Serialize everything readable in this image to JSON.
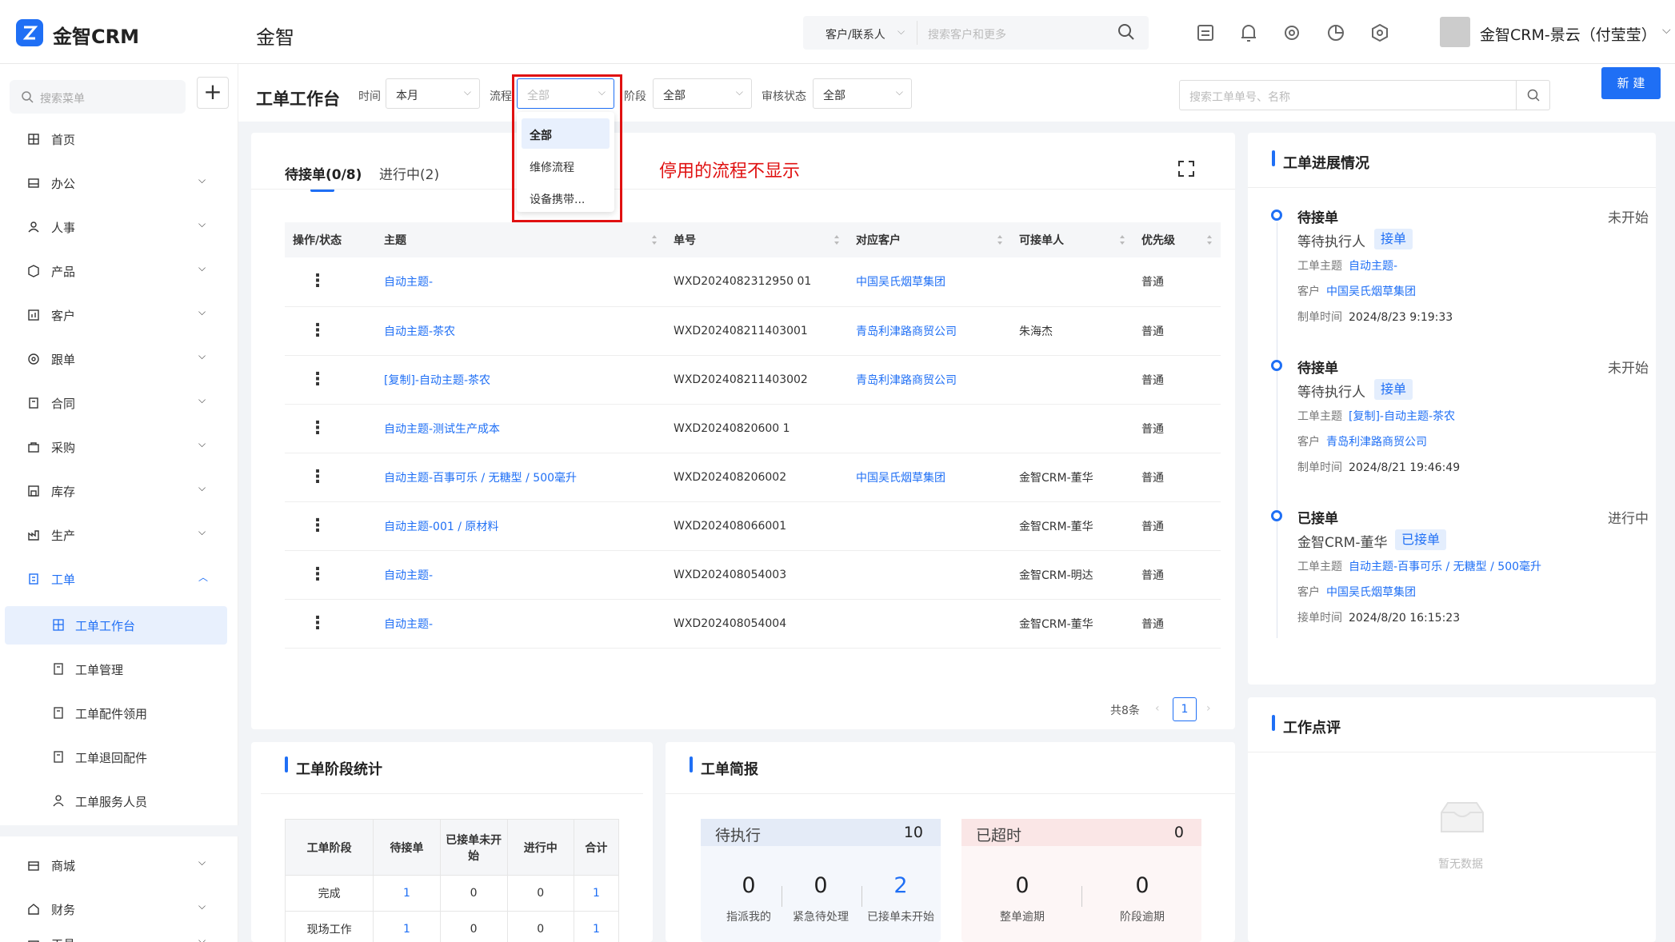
{
  "header": {
    "logo_text": "金智CRM",
    "app_name": "金智",
    "search_type": "客户/联系人",
    "search_placeholder": "搜索客户和更多",
    "user_name": "金智CRM-景云（付莹莹）"
  },
  "sidebar": {
    "search_placeholder": "搜索菜单",
    "items": [
      {
        "label": "首页",
        "icon": "grid-icon"
      },
      {
        "label": "办公",
        "icon": "inbox-icon"
      },
      {
        "label": "人事",
        "icon": "person-icon"
      },
      {
        "label": "产品",
        "icon": "box-icon"
      },
      {
        "label": "客户",
        "icon": "chart-icon"
      },
      {
        "label": "跟单",
        "icon": "target-icon"
      },
      {
        "label": "合同",
        "icon": "contract-icon"
      },
      {
        "label": "采购",
        "icon": "purchase-icon"
      },
      {
        "label": "库存",
        "icon": "warehouse-icon"
      },
      {
        "label": "生产",
        "icon": "production-icon"
      },
      {
        "label": "工单",
        "icon": "workorder-icon"
      },
      {
        "label": "商城",
        "icon": "mall-icon"
      },
      {
        "label": "财务",
        "icon": "finance-icon"
      },
      {
        "label": "工具",
        "icon": "tool-icon"
      }
    ],
    "sub_items": [
      {
        "label": "工单工作台"
      },
      {
        "label": "工单管理"
      },
      {
        "label": "工单配件领用"
      },
      {
        "label": "工单退回配件"
      },
      {
        "label": "工单服务人员"
      }
    ]
  },
  "filters": {
    "page_title": "工单工作台",
    "time_label": "时间",
    "time_value": "本月",
    "flow_label": "流程",
    "flow_value": "全部",
    "stage_label": "阶段",
    "stage_value": "全部",
    "audit_label": "审核状态",
    "audit_value": "全部",
    "search_placeholder": "搜索工单单号、名称",
    "new_button": "新 建"
  },
  "dropdown": {
    "options": [
      "全部",
      "维修流程",
      "设备携带..."
    ],
    "selected": "全部",
    "annotation": "停用的流程不显示"
  },
  "main": {
    "tabs": [
      {
        "label": "待接单(0/8)",
        "active": true
      },
      {
        "label": "进行中(2)",
        "active": false
      }
    ],
    "columns": [
      "操作/状态",
      "主题",
      "单号",
      "对应客户",
      "可接单人",
      "优先级"
    ],
    "rows": [
      {
        "subject": "自动主题-",
        "no": "WXD2024082312950 01",
        "customer": "中国吴氏烟草集团",
        "assignee": "",
        "priority": "普通"
      },
      {
        "subject": "自动主题-茶农",
        "no": "WXD202408211403001",
        "customer": "青岛利津路商贸公司",
        "assignee": "朱海杰",
        "priority": "普通"
      },
      {
        "subject": "[复制]-自动主题-茶农",
        "no": "WXD202408211403002",
        "customer": "青岛利津路商贸公司",
        "assignee": "",
        "priority": "普通"
      },
      {
        "subject": "自动主题-测试生产成本",
        "no": "WXD20240820600 1",
        "customer": "",
        "assignee": "",
        "priority": "普通"
      },
      {
        "subject": "自动主题-百事可乐 / 无糖型 / 500毫升",
        "no": "WXD202408206002",
        "customer": "中国吴氏烟草集团",
        "assignee": "金智CRM-董华",
        "priority": "普通"
      },
      {
        "subject": "自动主题-001 / 原材料",
        "no": "WXD202408066001",
        "customer": "",
        "assignee": "金智CRM-董华",
        "priority": "普通"
      },
      {
        "subject": "自动主题-",
        "no": "WXD202408054003",
        "customer": "",
        "assignee": "金智CRM-明达",
        "priority": "普通"
      },
      {
        "subject": "自动主题-",
        "no": "WXD202408054004",
        "customer": "",
        "assignee": "金智CRM-董华",
        "priority": "普通"
      }
    ],
    "total_text": "共8条",
    "current_page": "1"
  },
  "progress": {
    "title": "工单进展情况",
    "items": [
      {
        "title": "待接单",
        "status": "未开始",
        "who": "等待执行人",
        "tag": "接单",
        "subject_label": "工单主题",
        "subject": "自动主题-",
        "customer_label": "客户",
        "customer": "中国吴氏烟草集团",
        "time_label": "制单时间",
        "time": "2024/8/23 9:19:33"
      },
      {
        "title": "待接单",
        "status": "未开始",
        "who": "等待执行人",
        "tag": "接单",
        "subject_label": "工单主题",
        "subject": "[复制]-自动主题-茶农",
        "customer_label": "客户",
        "customer": "青岛利津路商贸公司",
        "time_label": "制单时间",
        "time": "2024/8/21 19:46:49"
      },
      {
        "title": "已接单",
        "status": "进行中",
        "who": "金智CRM-董华",
        "tag": "已接单",
        "subject_label": "工单主题",
        "subject": "自动主题-百事可乐 / 无糖型 / 500毫升",
        "customer_label": "客户",
        "customer": "中国吴氏烟草集团",
        "time_label": "接单时间",
        "time": "2024/8/20 16:15:23"
      }
    ]
  },
  "review": {
    "title": "工作点评",
    "empty_text": "暂无数据"
  },
  "stage_stats": {
    "title": "工单阶段统计",
    "columns": [
      "工单阶段",
      "待接单",
      "已接单未开始",
      "进行中",
      "合计"
    ],
    "rows": [
      [
        "完成",
        "1",
        "0",
        "0",
        "1"
      ],
      [
        "现场工作",
        "1",
        "0",
        "0",
        "1"
      ]
    ]
  },
  "brief": {
    "title": "工单简报",
    "pending": {
      "label": "待执行",
      "count": "10",
      "stats": [
        {
          "value": "0",
          "label": "指派我的"
        },
        {
          "value": "0",
          "label": "紧急待处理"
        },
        {
          "value": "2",
          "label": "已接单未开始"
        }
      ]
    },
    "overdue": {
      "label": "已超时",
      "count": "0",
      "stats": [
        {
          "value": "0",
          "label": "整单逾期"
        },
        {
          "value": "0",
          "label": "阶段逾期"
        }
      ]
    }
  },
  "colors": {
    "accent": "#1f6ff5",
    "annotation": "#e01111"
  }
}
